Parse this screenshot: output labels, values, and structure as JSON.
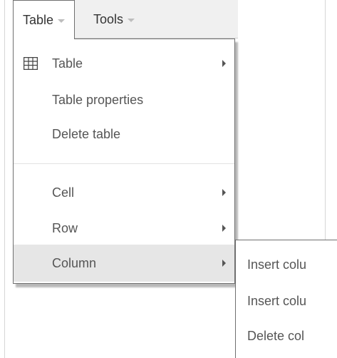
{
  "menubar": {
    "items": [
      {
        "label": "Table",
        "active": true
      },
      {
        "label": "Tools",
        "active": false
      }
    ]
  },
  "dropdown": {
    "items": [
      {
        "label": "Table",
        "icon": "table-grid-icon",
        "has_submenu": true
      },
      {
        "label": "Table properties",
        "has_submenu": false
      },
      {
        "label": "Delete table",
        "has_submenu": false
      },
      {
        "label": "Cell",
        "has_submenu": true
      },
      {
        "label": "Row",
        "has_submenu": true
      },
      {
        "label": "Column",
        "has_submenu": true,
        "highlighted": true
      }
    ]
  },
  "submenu": {
    "items": [
      {
        "label": "Insert colu"
      },
      {
        "label": "Insert colu"
      },
      {
        "label": "Delete col"
      }
    ]
  },
  "colors": {
    "menubar_bg": "#f0f0f0",
    "highlight_bg": "#e6e6e6",
    "text": "#555555",
    "border": "#6f6f6f"
  }
}
